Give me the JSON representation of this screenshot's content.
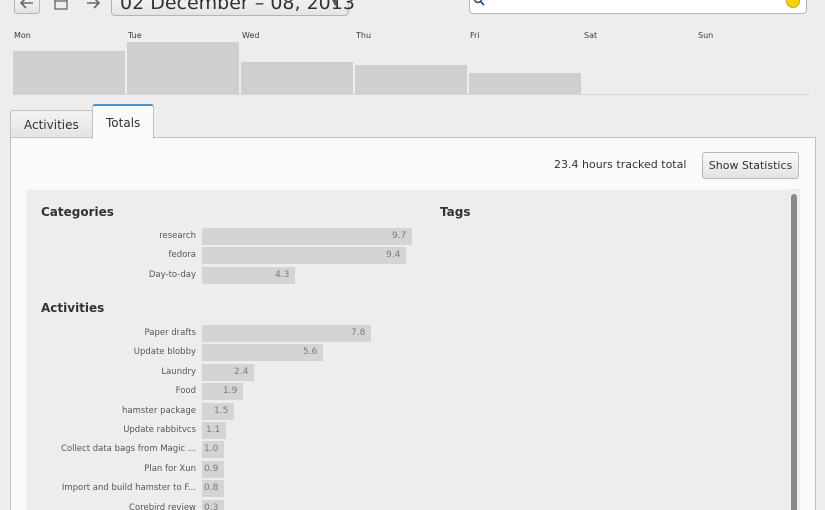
{
  "toolbar": {
    "prev_icon": "back-arrow-icon",
    "calendar_icon": "calendar-icon",
    "next_icon": "forward-arrow-icon",
    "range_label": "02 December – 08, 2013",
    "search_icon": "search-icon",
    "clear_icon": "clear-icon"
  },
  "week": {
    "days": [
      {
        "label": "Mon",
        "level": 0.83
      },
      {
        "label": "Tue",
        "level": 1.0
      },
      {
        "label": "Wed",
        "level": 0.61
      },
      {
        "label": "Thu",
        "level": 0.56
      },
      {
        "label": "Fri",
        "level": 0.41
      },
      {
        "label": "Sat",
        "level": 0
      },
      {
        "label": "Sun",
        "level": 0
      }
    ]
  },
  "tabs": [
    {
      "label": "Activities",
      "active": false
    },
    {
      "label": "Totals",
      "active": true
    }
  ],
  "totals": {
    "summary": "23.4 hours tracked total",
    "show_statistics": "Show Statistics",
    "categories_title": "Categories",
    "tags_title": "Tags",
    "activities_title": "Activities",
    "categories": [
      {
        "label": "research",
        "value": "9.7"
      },
      {
        "label": "fedora",
        "value": "9.4"
      },
      {
        "label": "Day-to-day",
        "value": "4.3"
      }
    ],
    "activities": [
      {
        "label": "Paper drafts",
        "value": "7.8"
      },
      {
        "label": "Update blobby",
        "value": "5.6"
      },
      {
        "label": "Laundry",
        "value": "2.4"
      },
      {
        "label": "Food",
        "value": "1.9"
      },
      {
        "label": "hamster package",
        "value": "1.5"
      },
      {
        "label": "Update rabbitvcs",
        "value": "1.1"
      },
      {
        "label": "Collect data bags from Magic ...",
        "value": "1.0"
      },
      {
        "label": "Plan for Xun",
        "value": "0.9"
      },
      {
        "label": "Import and build hamster to F...",
        "value": "0.8"
      },
      {
        "label": "Corebird review",
        "value": "0.3"
      }
    ]
  }
}
